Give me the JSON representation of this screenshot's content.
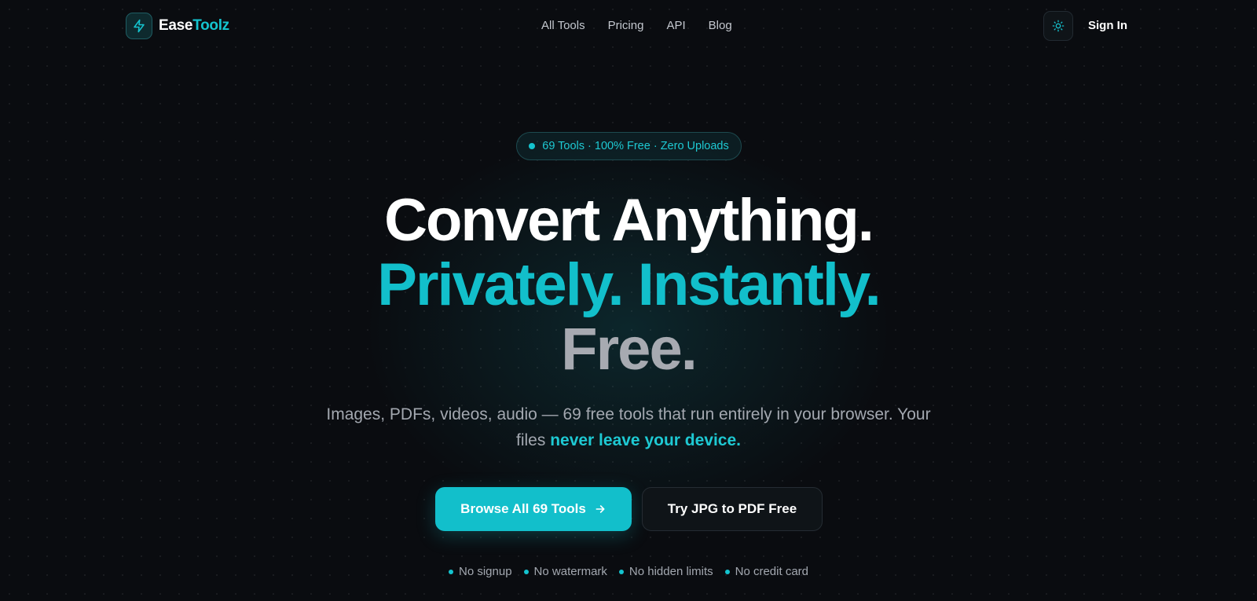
{
  "nav": {
    "logo": {
      "part1": "Ease",
      "part2": "Toolz",
      "icon": "bolt-icon"
    },
    "links": [
      {
        "label": "All Tools"
      },
      {
        "label": "Pricing"
      },
      {
        "label": "API"
      },
      {
        "label": "Blog"
      }
    ],
    "theme_toggle_icon": "sun-icon",
    "sign_in_label": "Sign In"
  },
  "hero": {
    "badge": "69 Tools · 100% Free · Zero Uploads",
    "headline": {
      "line1": "Convert Anything.",
      "line2": "Privately. Instantly.",
      "line3": "Free."
    },
    "subtitle": {
      "text_before": "Images, PDFs, videos, audio — 69 free tools that run entirely in your browser. Your files ",
      "highlight": "never leave your device."
    },
    "primary_cta": "Browse All 69 Tools",
    "secondary_cta": "Try JPG to PDF Free",
    "features": [
      {
        "label": "No signup"
      },
      {
        "label": "No watermark"
      },
      {
        "label": "No hidden limits"
      },
      {
        "label": "No credit card"
      }
    ]
  },
  "colors": {
    "accent": "#12bfcb",
    "background": "#0a0c10",
    "muted_text": "#a3a8b0"
  }
}
